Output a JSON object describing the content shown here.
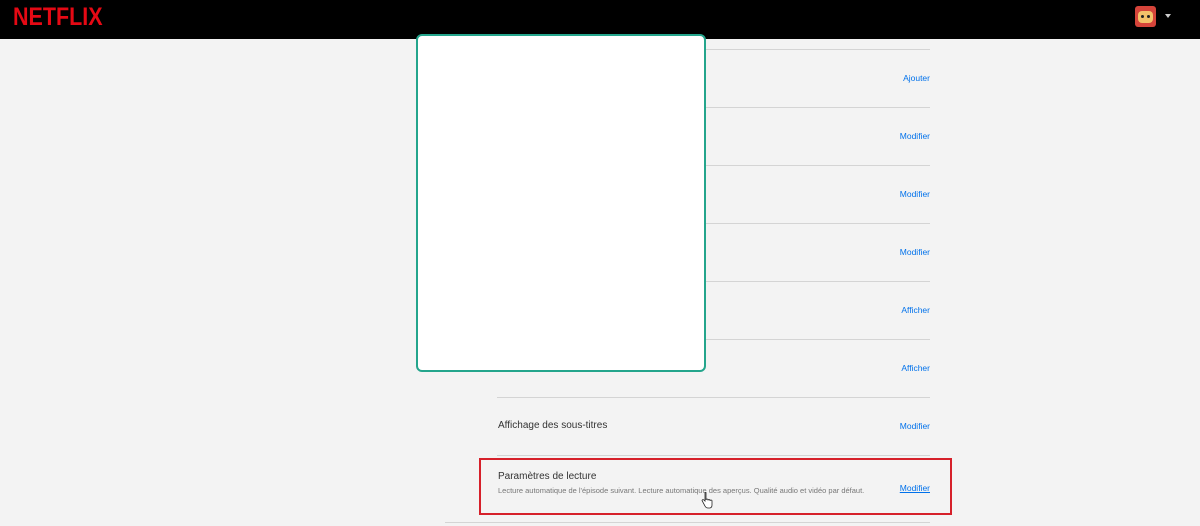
{
  "header": {
    "logo_text": "NETFLIX",
    "profile_icon": "profile-avatar-icon",
    "caret_icon": "caret-down-icon"
  },
  "settings": {
    "rows": [
      {
        "title": "",
        "description": "",
        "action": "Ajouter"
      },
      {
        "title": "",
        "description": "",
        "action": "Modifier"
      },
      {
        "title": "",
        "description": "",
        "action": "Modifier"
      },
      {
        "title": "",
        "description": "",
        "action": "Modifier"
      },
      {
        "title": "",
        "description": "",
        "action": "Afficher"
      },
      {
        "title": "",
        "description": "",
        "action": "Afficher"
      },
      {
        "title": "Affichage des sous-titres",
        "description": "",
        "action": "Modifier"
      },
      {
        "title": "Paramètres de lecture",
        "description": "Lecture automatique de l'épisode suivant. Lecture automatique des aperçus. Qualité audio et vidéo par défaut.",
        "action": "Modifier"
      }
    ]
  },
  "colors": {
    "brand": "#e50914",
    "link": "#0071eb",
    "highlight": "#d6202a",
    "dialog_border": "#24a58c"
  }
}
